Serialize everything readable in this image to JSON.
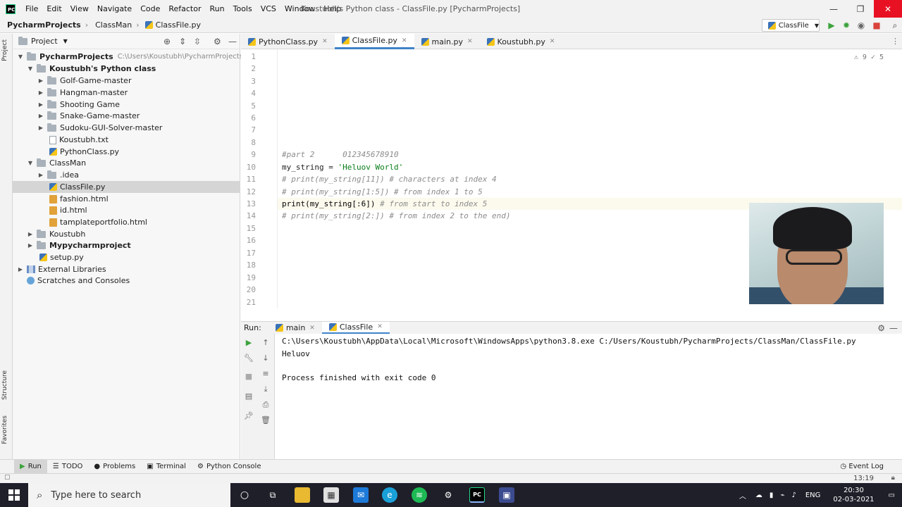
{
  "menubar": {
    "items": [
      "File",
      "Edit",
      "View",
      "Navigate",
      "Code",
      "Refactor",
      "Run",
      "Tools",
      "VCS",
      "Window",
      "Help"
    ],
    "window_title": "Koustubh's Python class - ClassFile.py [PycharmProjects]",
    "logo_text": "PC"
  },
  "navbar": {
    "crumbs": [
      "PycharmProjects",
      "ClassMan",
      "ClassFile.py"
    ],
    "run_config": "ClassFile"
  },
  "left_stripe": {
    "project": "Project",
    "structure": "Structure",
    "favorites": "Favorites"
  },
  "project_panel": {
    "title": "Project",
    "root": {
      "label": "PycharmProjects",
      "path": "C:\\Users\\Koustubh\\PycharmProjects"
    },
    "items": [
      "Koustubh's Python class",
      "Golf-Game-master",
      "Hangman-master",
      "Shooting Game",
      "Snake-Game-master",
      "Sudoku-GUI-Solver-master",
      "Koustubh.txt",
      "PythonClass.py",
      "ClassMan",
      ".idea",
      "ClassFile.py",
      "fashion.html",
      "id.html",
      "tamplateportfolio.html",
      "Koustubh",
      "Mypycharmproject",
      "setup.py",
      "External Libraries",
      "Scratches and Consoles"
    ]
  },
  "editor_tabs": [
    "PythonClass.py",
    "ClassFile.py",
    "main.py",
    "Koustubh.py"
  ],
  "editor": {
    "inspection": "⚠ 9  ✓ 5",
    "line_numbers": [
      "1",
      "2",
      "3",
      "4",
      "5",
      "6",
      "7",
      "8",
      "9",
      "10",
      "11",
      "12",
      "13",
      "14",
      "15",
      "16",
      "17",
      "18",
      "19",
      "20",
      "21"
    ],
    "line9": "#part 2      012345678910",
    "line10_var": "my_string = ",
    "line10_str": "'Heluov World'",
    "line11": "# print(my_string[11]) # characters at index 4",
    "line12": "# print(my_string[1:5]) # from index 1 to 5",
    "line13_code": "print(my_string[:6])",
    "line13_comment": " # from start to index 5",
    "line14": "# print(my_string[2:]) # from index 2 to the end)"
  },
  "run_panel": {
    "label": "Run:",
    "tabs": [
      "main",
      "ClassFile"
    ],
    "output": [
      "C:\\Users\\Koustubh\\AppData\\Local\\Microsoft\\WindowsApps\\python3.8.exe C:/Users/Koustubh/PycharmProjects/ClassMan/ClassFile.py",
      "Heluov",
      "",
      "Process finished with exit code 0"
    ]
  },
  "tool_tabs": [
    "Run",
    "TODO",
    "Problems",
    "Terminal",
    "Python Console"
  ],
  "event_log": "Event Log",
  "status": {
    "caret": "13:19"
  },
  "taskbar": {
    "search_placeholder": "Type here to search",
    "lang": "ENG",
    "time": "20:30",
    "date": "02-03-2021"
  }
}
